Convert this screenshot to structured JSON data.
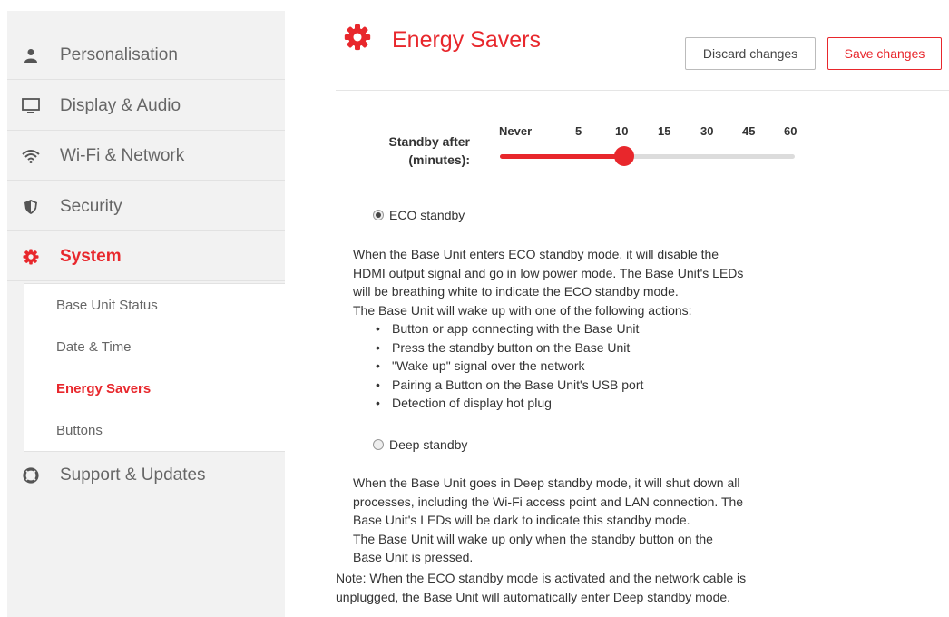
{
  "sidebar": {
    "items": [
      {
        "label": "Personalisation",
        "icon": "person-icon"
      },
      {
        "label": "Display & Audio",
        "icon": "monitor-icon"
      },
      {
        "label": "Wi-Fi & Network",
        "icon": "wifi-icon"
      },
      {
        "label": "Security",
        "icon": "shield-icon"
      },
      {
        "label": "System",
        "icon": "gear-icon"
      },
      {
        "label": "Support & Updates",
        "icon": "lifebuoy-icon"
      }
    ],
    "sub_items": [
      "Base Unit Status",
      "Date & Time",
      "Energy Savers",
      "Buttons"
    ],
    "active_item": "System",
    "active_sub_item": "Energy Savers"
  },
  "header": {
    "title": "Energy Savers",
    "discard_label": "Discard changes",
    "save_label": "Save changes"
  },
  "slider": {
    "label_line1": "Standby after",
    "label_line2": "(minutes):",
    "ticks": [
      "Never",
      "5",
      "10",
      "15",
      "30",
      "45",
      "60"
    ],
    "selected": "10",
    "selected_index": 2
  },
  "eco": {
    "label": "ECO standby",
    "selected": true,
    "description": [
      "When the Base Unit enters ECO standby mode, it will disable the",
      "HDMI output signal and go in low power mode. The Base Unit's LEDs",
      "will be breathing white to indicate the ECO standby mode.",
      "The Base Unit will wake up with one of the following actions:"
    ],
    "actions": [
      "Button or app connecting with the Base Unit",
      "Press the standby button on the Base Unit",
      "\"Wake up\" signal over the network",
      "Pairing a Button on the Base Unit's USB port",
      "Detection of display hot plug"
    ]
  },
  "deep": {
    "label": "Deep standby",
    "selected": false,
    "description": [
      "When the Base Unit goes in Deep standby mode, it will shut down all",
      "processes, including the Wi-Fi access point and LAN connection. The",
      "Base Unit's LEDs will be dark to indicate this standby mode.",
      "The Base Unit will wake up only when the standby button on the",
      "Base Unit is pressed."
    ]
  },
  "note": [
    "Note: When the ECO standby mode is activated and the network cable is",
    "unplugged, the Base Unit will automatically enter Deep standby mode."
  ],
  "colors": {
    "accent": "#e8272c",
    "icon": "#555555",
    "sidebar_bg": "#f2f2f2"
  }
}
